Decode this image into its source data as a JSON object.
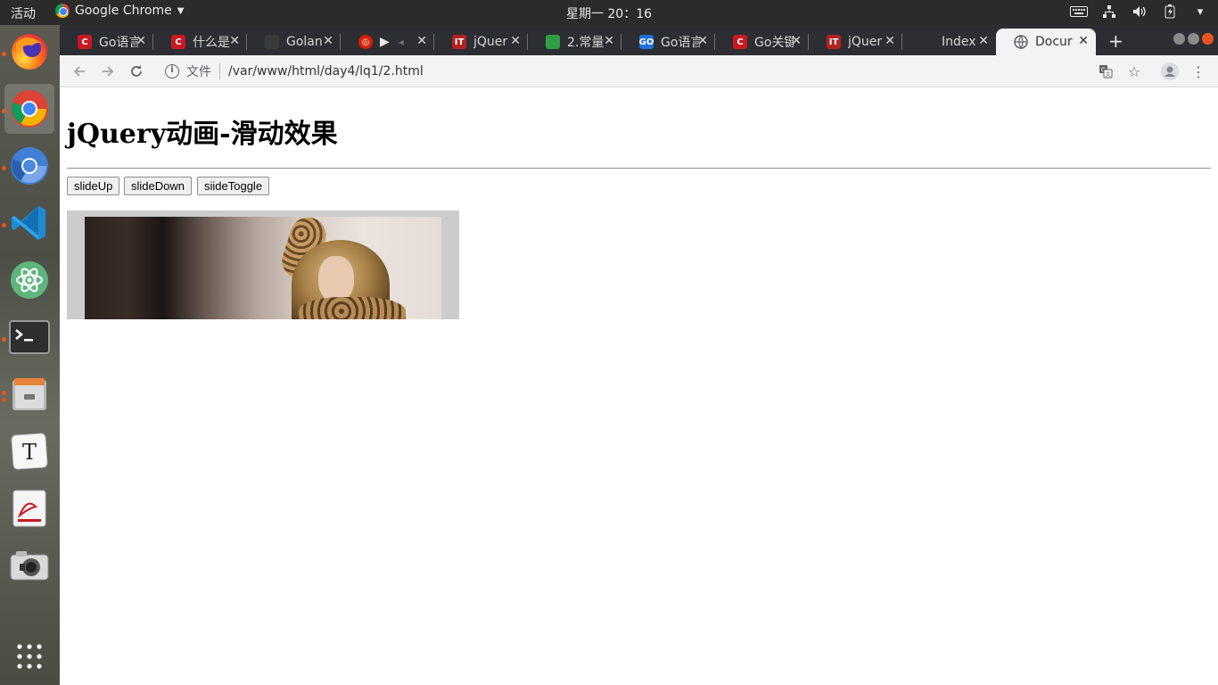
{
  "topbar": {
    "activities": "活动",
    "app_name": "Google Chrome",
    "clock": "星期一 20：16"
  },
  "dock": {
    "apps": [
      {
        "name": "firefox-icon",
        "running": true
      },
      {
        "name": "chrome-icon",
        "running": true,
        "active": true
      },
      {
        "name": "chromium-icon",
        "running": true
      },
      {
        "name": "vscode-icon",
        "running": true
      },
      {
        "name": "atom-icon",
        "running": false
      },
      {
        "name": "terminal-icon",
        "running": true
      },
      {
        "name": "files-icon",
        "running": true
      },
      {
        "name": "typora-icon",
        "running": false
      },
      {
        "name": "pdf-reader-icon",
        "running": false
      },
      {
        "name": "camera-icon",
        "running": false
      },
      {
        "name": "show-apps-icon",
        "running": false
      }
    ]
  },
  "tabs": [
    {
      "title": "Go语言",
      "favicon": "C",
      "favcolor": "#c9181f"
    },
    {
      "title": "什么是",
      "favicon": "C",
      "favcolor": "#c9181f"
    },
    {
      "title": "Golan",
      "favicon": "gh",
      "favcolor": "#3a3a3a"
    },
    {
      "title": "",
      "favicon": "163",
      "favcolor": "#d81e06"
    },
    {
      "title": "jQuer",
      "favicon": "IT",
      "favcolor": "#b22222"
    },
    {
      "title": "2.常量",
      "favicon": "~",
      "favcolor": "#2f9e44"
    },
    {
      "title": "Go语言",
      "favicon": "GO",
      "favcolor": "#1e6fd9"
    },
    {
      "title": "Go关键",
      "favicon": "C",
      "favcolor": "#c9181f"
    },
    {
      "title": "jQuer",
      "favicon": "IT",
      "favcolor": "#b22222"
    },
    {
      "title": "Index",
      "favicon": "",
      "favcolor": "#3a3c40"
    },
    {
      "title": "Docur",
      "favicon": "globe",
      "favcolor": "#5f6368",
      "active": true
    }
  ],
  "omnibox": {
    "security_label": "文件",
    "url": "/var/www/html/day4/lq1/2.html"
  },
  "page": {
    "heading": "jQuery动画-滑动效果",
    "buttons": [
      "slideUp",
      "slideDown",
      "siideToggle"
    ]
  }
}
